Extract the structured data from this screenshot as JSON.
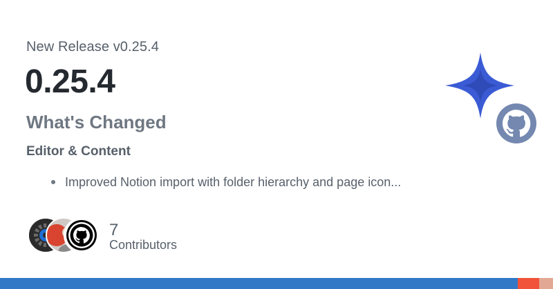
{
  "release": {
    "subtitle": "New Release v0.25.4",
    "version": "0.25.4",
    "section_title": "What's Changed",
    "subsection_title": "Editor & Content",
    "bullets": [
      "Improved Notion import with folder hierarchy and page icon..."
    ]
  },
  "contributors": {
    "count": "7",
    "label": "Contributors",
    "avatars": [
      "avatar-gear",
      "avatar-person",
      "avatar-github"
    ]
  },
  "logo": {
    "icon": "four-point-star-icon",
    "badge_icon": "github-icon",
    "star_color": "#3b5bd5",
    "badge_color": "#7488b0"
  },
  "bottom_bar": {
    "colors": [
      "#3178c6",
      "#f1523a",
      "#e2a893"
    ]
  }
}
